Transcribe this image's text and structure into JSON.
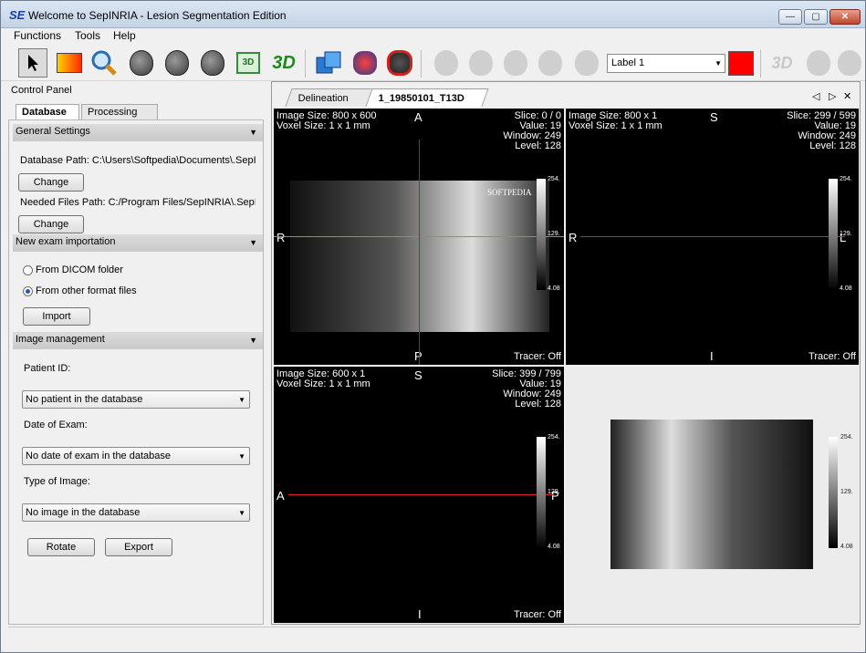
{
  "window": {
    "title": "Welcome to SepINRIA - Lesion Segmentation Edition",
    "logo": "SE",
    "controls": {
      "minimize": "—",
      "maximize": "▢",
      "close": "✕"
    }
  },
  "menu": [
    "Functions",
    "Tools",
    "Help"
  ],
  "toolbar": {
    "tools": [
      "pointer-icon",
      "gradient-icon",
      "zoom-icon",
      "brain-axial-icon",
      "brain-coronal-icon",
      "brain-sagittal-icon",
      "3d-view-icon",
      "3d-text-icon",
      "copy-layers-icon",
      "brain-red-icon",
      "brain-red-arrows-icon"
    ],
    "tools_3d_label": "3D",
    "label_select": "Label 1",
    "label_color": "#ff0000"
  },
  "control_panel": {
    "title": "Control Panel",
    "tabs": [
      "Database",
      "Processing"
    ],
    "general_settings": {
      "header": "General Settings",
      "database_path": "Database Path:  C:\\Users\\Softpedia\\Documents\\.SepI",
      "change_label": "Change",
      "needed_files_path": "Needed Files Path:  C:/Program Files/SepINRIA\\.SepIr",
      "change_label2": "Change"
    },
    "import_section": {
      "header": "New exam importation",
      "option_dicom": "From DICOM folder",
      "option_other": "From other format files",
      "import_label": "Import"
    },
    "image_management": {
      "header": "Image management",
      "patient_label": "Patient ID:",
      "patient_value": "No patient in the database",
      "date_label": "Date of Exam:",
      "date_value": "No date of exam in the database",
      "type_label": "Type of Image:",
      "type_value": "No image in the database",
      "rotate_label": "Rotate",
      "export_label": "Export"
    }
  },
  "viewer": {
    "tabs": [
      "Delineation",
      "1_19850101_T13D"
    ],
    "nav": {
      "prev": "◁",
      "next": "▷",
      "close": "✕"
    },
    "panes": [
      {
        "size": "Image Size: 800 x 600",
        "voxel": "Voxel Size: 1 x 1 mm",
        "slice": "Slice: 0 / 0",
        "value": "Value: 19",
        "window": "Window: 249",
        "level": "Level: 128",
        "top": "A",
        "left": "R",
        "right": "L",
        "bottom": "P",
        "tracer": "Tracer: Off"
      },
      {
        "size": "Image Size: 800 x 1",
        "voxel": "Voxel Size: 1 x 1 mm",
        "slice": "Slice: 299 / 599",
        "value": "Value: 19",
        "window": "Window: 249",
        "level": "Level: 128",
        "top": "S",
        "left": "R",
        "right": "L",
        "bottom": "I",
        "tracer": "Tracer: Off"
      },
      {
        "size": "Image Size: 600 x 1",
        "voxel": "Voxel Size: 1 x 1 mm",
        "slice": "Slice: 399 / 799",
        "value": "Value: 19",
        "window": "Window: 249",
        "level": "Level: 128",
        "top": "S",
        "left": "A",
        "right": "P",
        "bottom": "I",
        "tracer": "Tracer: Off"
      }
    ],
    "colorbar": {
      "max": "254.",
      "mid": "129.",
      "min": "4.08"
    },
    "watermark": "SOFTPEDIA"
  }
}
